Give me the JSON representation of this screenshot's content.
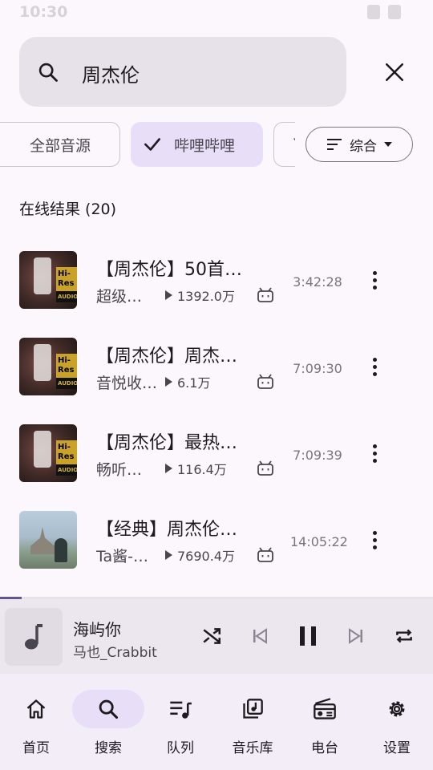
{
  "status": {
    "time": "10:30"
  },
  "search": {
    "query": "周杰伦"
  },
  "filters": {
    "chips": [
      "全部音源",
      "哔哩哔哩",
      "Y"
    ],
    "sort_label": "综合"
  },
  "section": {
    "title": "在线结果 (20)"
  },
  "results": [
    {
      "title": "【周杰伦】50首…",
      "uploader": "超级…",
      "plays": "1392.0万",
      "duration": "3:42:28",
      "thumb": "hires"
    },
    {
      "title": "【周杰伦】周杰…",
      "uploader": "音悦收…",
      "plays": "6.1万",
      "duration": "7:09:30",
      "thumb": "hires"
    },
    {
      "title": "【周杰伦】最热…",
      "uploader": "畅听…",
      "plays": "116.4万",
      "duration": "7:09:39",
      "thumb": "hires"
    },
    {
      "title": "【经典】周杰伦…",
      "uploader": "Ta酱-…",
      "plays": "7690.4万",
      "duration": "14:05:22",
      "thumb": "castle"
    }
  ],
  "thumb_badge": {
    "line1": "Hi-Res",
    "line2": "AUDIO"
  },
  "player": {
    "title": "海屿你",
    "artist": "马也_Crabbit",
    "progress": 0.05
  },
  "nav": {
    "items": [
      {
        "label": "首页",
        "icon": "home-icon"
      },
      {
        "label": "搜索",
        "icon": "search-icon"
      },
      {
        "label": "队列",
        "icon": "queue-icon"
      },
      {
        "label": "音乐库",
        "icon": "library-icon"
      },
      {
        "label": "电台",
        "icon": "radio-icon"
      },
      {
        "label": "设置",
        "icon": "settings-icon"
      }
    ],
    "active": 1
  },
  "colors": {
    "accent": "#65558f",
    "chip_selected": "#e8def8",
    "background": "#fcf7fc"
  }
}
